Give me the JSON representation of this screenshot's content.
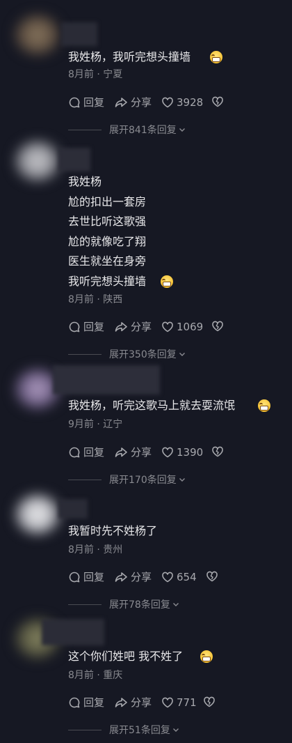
{
  "comments": [
    {
      "text_lines": [
        "我姓杨，我听完想头撞墙"
      ],
      "emoji_on_last_line": true,
      "meta": "8月前 · 宁夏",
      "reply_label": "回复",
      "share_label": "分享",
      "likes": "3928",
      "expand_label": "展开841条回复"
    },
    {
      "text_lines": [
        "我姓杨",
        "尬的扣出一套房",
        "去世比听这歌强",
        "尬的就像吃了翔",
        "医生就坐在身旁",
        "我听完想头撞墙"
      ],
      "emoji_on_last_line": true,
      "meta": "8月前 · 陕西",
      "reply_label": "回复",
      "share_label": "分享",
      "likes": "1069",
      "expand_label": "展开350条回复"
    },
    {
      "text_lines": [
        "我姓杨，听完这歌马上就去耍流氓"
      ],
      "emoji_on_last_line": true,
      "meta": "9月前 · 辽宁",
      "reply_label": "回复",
      "share_label": "分享",
      "likes": "1390",
      "expand_label": "展开170条回复"
    },
    {
      "text_lines": [
        "我暂时先不姓杨了"
      ],
      "emoji_on_last_line": false,
      "meta": "8月前 · 贵州",
      "reply_label": "回复",
      "share_label": "分享",
      "likes": "654",
      "expand_label": "展开78条回复"
    },
    {
      "text_lines": [
        "这个你们姓吧 我不姓了"
      ],
      "emoji_on_last_line": true,
      "meta": "8月前 · 重庆",
      "reply_label": "回复",
      "share_label": "分享",
      "likes": "771",
      "expand_label": "展开51条回复"
    }
  ],
  "icons": {
    "reply": "comment-bubble-icon",
    "share": "share-arrow-icon",
    "like": "heart-icon",
    "dislike": "broken-heart-icon",
    "expand": "chevron-down-icon",
    "emoji": "grimace-emoji-icon"
  },
  "colors": {
    "background": "#161823",
    "text": "#e8e8ea",
    "meta": "#8a8b91",
    "action": "#a8a9ae"
  }
}
